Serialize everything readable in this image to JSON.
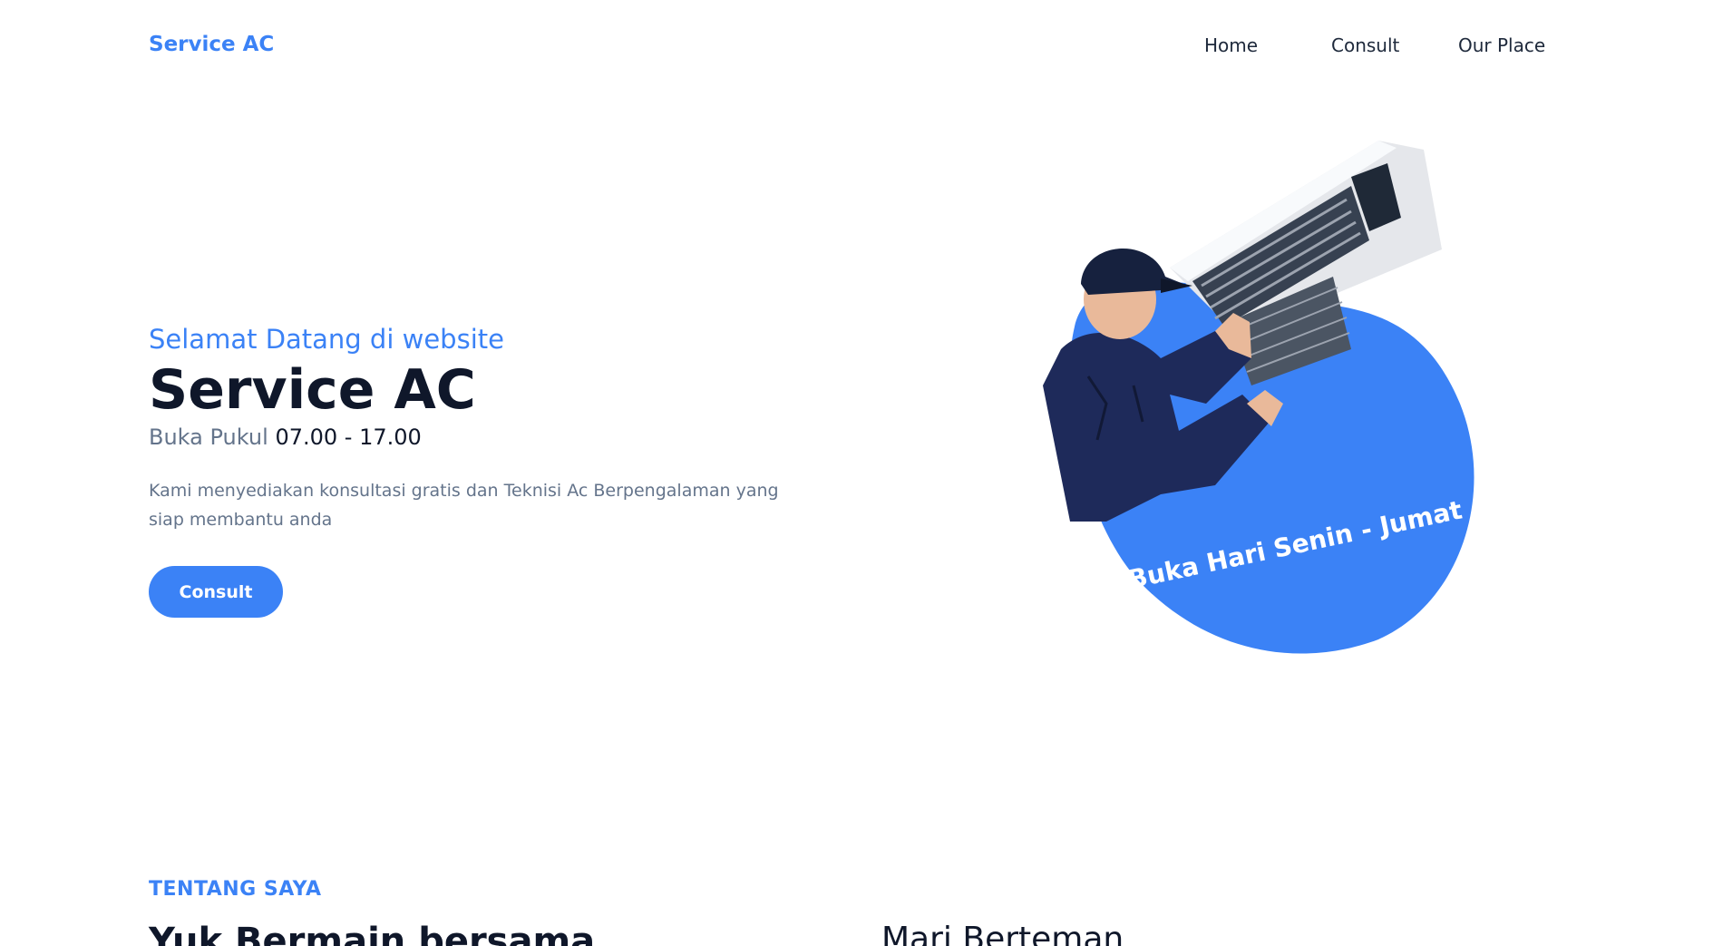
{
  "navbar": {
    "brand": "Service AC",
    "links": [
      {
        "label": "Home"
      },
      {
        "label": "Consult"
      },
      {
        "label": "Our Place"
      }
    ]
  },
  "hero": {
    "subtitle": "Selamat Datang di website",
    "title": "Service AC",
    "hours_label": "Buka Pukul",
    "hours_time": "07.00 - 17.00",
    "description": "Kami menyediakan konsultasi gratis dan Teknisi Ac Berpengalaman yang siap membantu anda",
    "cta_label": "Consult",
    "badge_text": "Buka Hari Senin - Jumat"
  },
  "about": {
    "kicker": "TENTANG SAYA",
    "heading": "Yuk Bermain bersama",
    "heading_right": "Mari Berteman"
  },
  "colors": {
    "accent": "#3b82f6",
    "text_dark": "#0f172a",
    "text_muted": "#64748b"
  }
}
